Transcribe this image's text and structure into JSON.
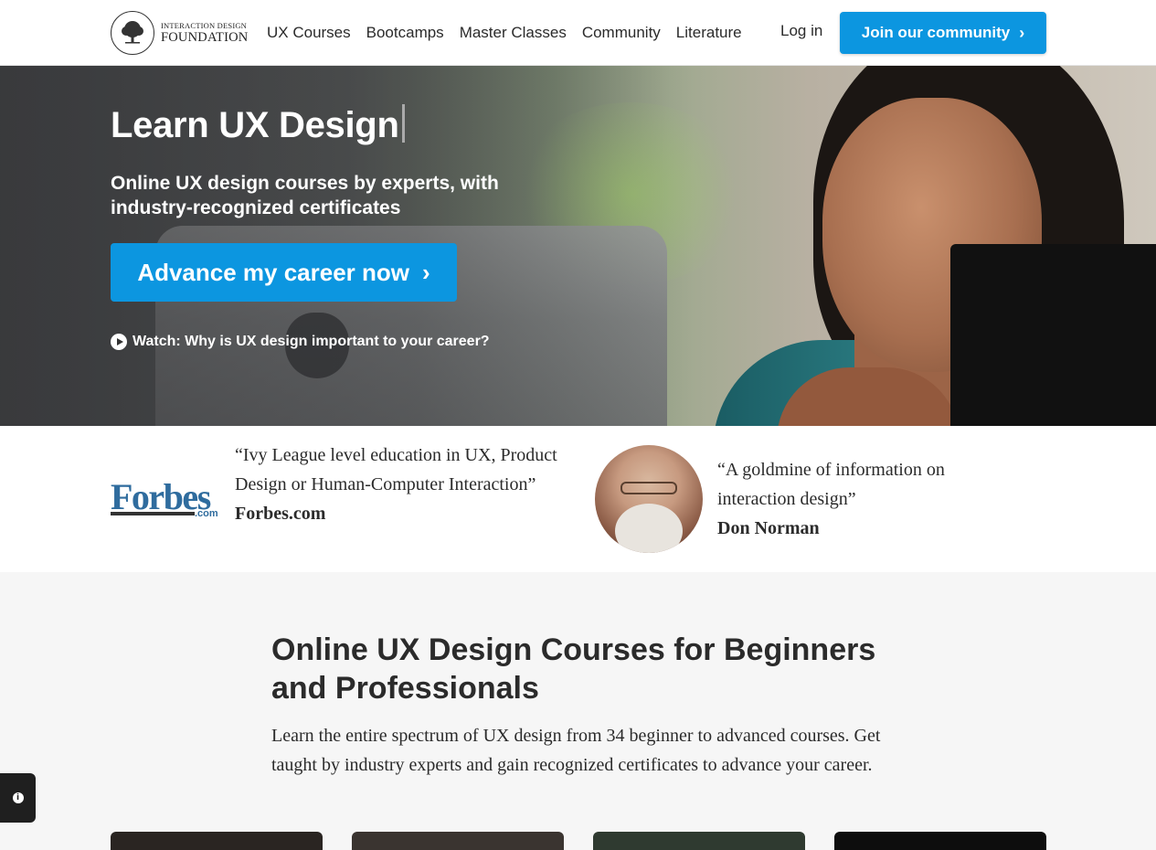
{
  "header": {
    "logo": {
      "line1": "INTERACTION DESIGN",
      "line2": "FOUNDATION"
    },
    "nav": [
      {
        "label": "UX Courses"
      },
      {
        "label": "Bootcamps"
      },
      {
        "label": "Master Classes"
      },
      {
        "label": "Community"
      },
      {
        "label": "Literature"
      }
    ],
    "login_label": "Log in",
    "join_label": "Join our community"
  },
  "hero": {
    "title": "Learn UX Design",
    "subtitle": "Online UX design courses by experts, with industry-recognized certificates",
    "cta_label": "Advance my career now",
    "watch_label": "Watch: Why is UX design important to your career?"
  },
  "testimonials": [
    {
      "logo": "Forbes",
      "logo_suffix": ".com",
      "quote": "“Ivy League level education in UX, Product Design or Human-Computer Interaction”",
      "source": "Forbes.com"
    },
    {
      "quote": "“A goldmine of information on interaction design”",
      "source": "Don Norman"
    }
  ],
  "courses_section": {
    "title": "Online UX Design Courses for Beginners and Professionals",
    "body": "Learn the entire spectrum of UX design from 34 beginner to advanced courses. Get taught by industry experts and gain recognized certificates to advance your career."
  },
  "colors": {
    "accent": "#0c96e0",
    "text": "#2b2b2b",
    "forbes": "#2f6c9e"
  }
}
